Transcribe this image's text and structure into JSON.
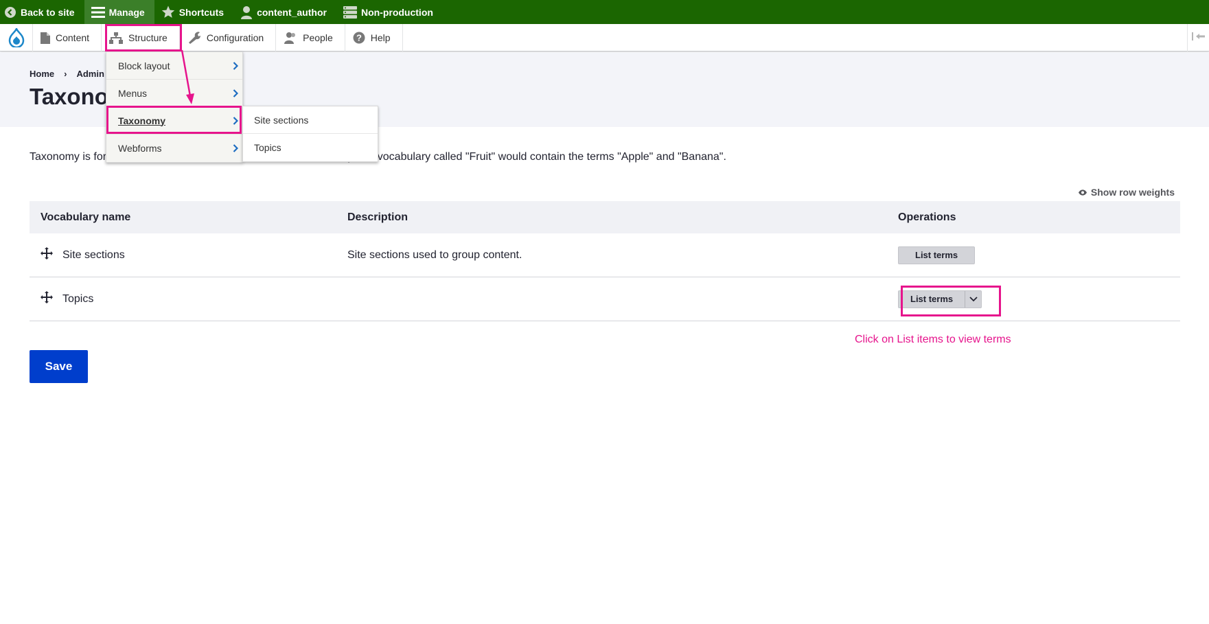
{
  "topbar": {
    "back": "Back to site",
    "manage": "Manage",
    "shortcuts": "Shortcuts",
    "user": "content_author",
    "environment": "Non-production"
  },
  "toolbar": {
    "tabs": [
      "Content",
      "Structure",
      "Configuration",
      "People",
      "Help"
    ]
  },
  "structure_menu": {
    "items": [
      "Block layout",
      "Menus",
      "Taxonomy",
      "Webforms"
    ],
    "taxonomy_submenu": [
      "Site sections",
      "Topics"
    ]
  },
  "breadcrumb": [
    "Home",
    "Admin"
  ],
  "page_title": "Taxonomy",
  "intro_start": "Taxonomy is for",
  "intro_end": "aries. For example, a vocabulary called \"Fruit\" would contain the terms \"Apple\" and \"Banana\".",
  "show_row_weights": "Show row weights",
  "table": {
    "headers": [
      "Vocabulary name",
      "Description",
      "Operations"
    ],
    "rows": [
      {
        "name": "Site sections",
        "description": "Site sections used to group content.",
        "operation": "List terms"
      },
      {
        "name": "Topics",
        "description": "",
        "operation": "List terms"
      }
    ]
  },
  "annotation": "Click on List items to view terms",
  "save_label": "Save",
  "colors": {
    "topbar": "#1b6601",
    "accent": "#003ecc",
    "annotation": "#e6148c"
  }
}
